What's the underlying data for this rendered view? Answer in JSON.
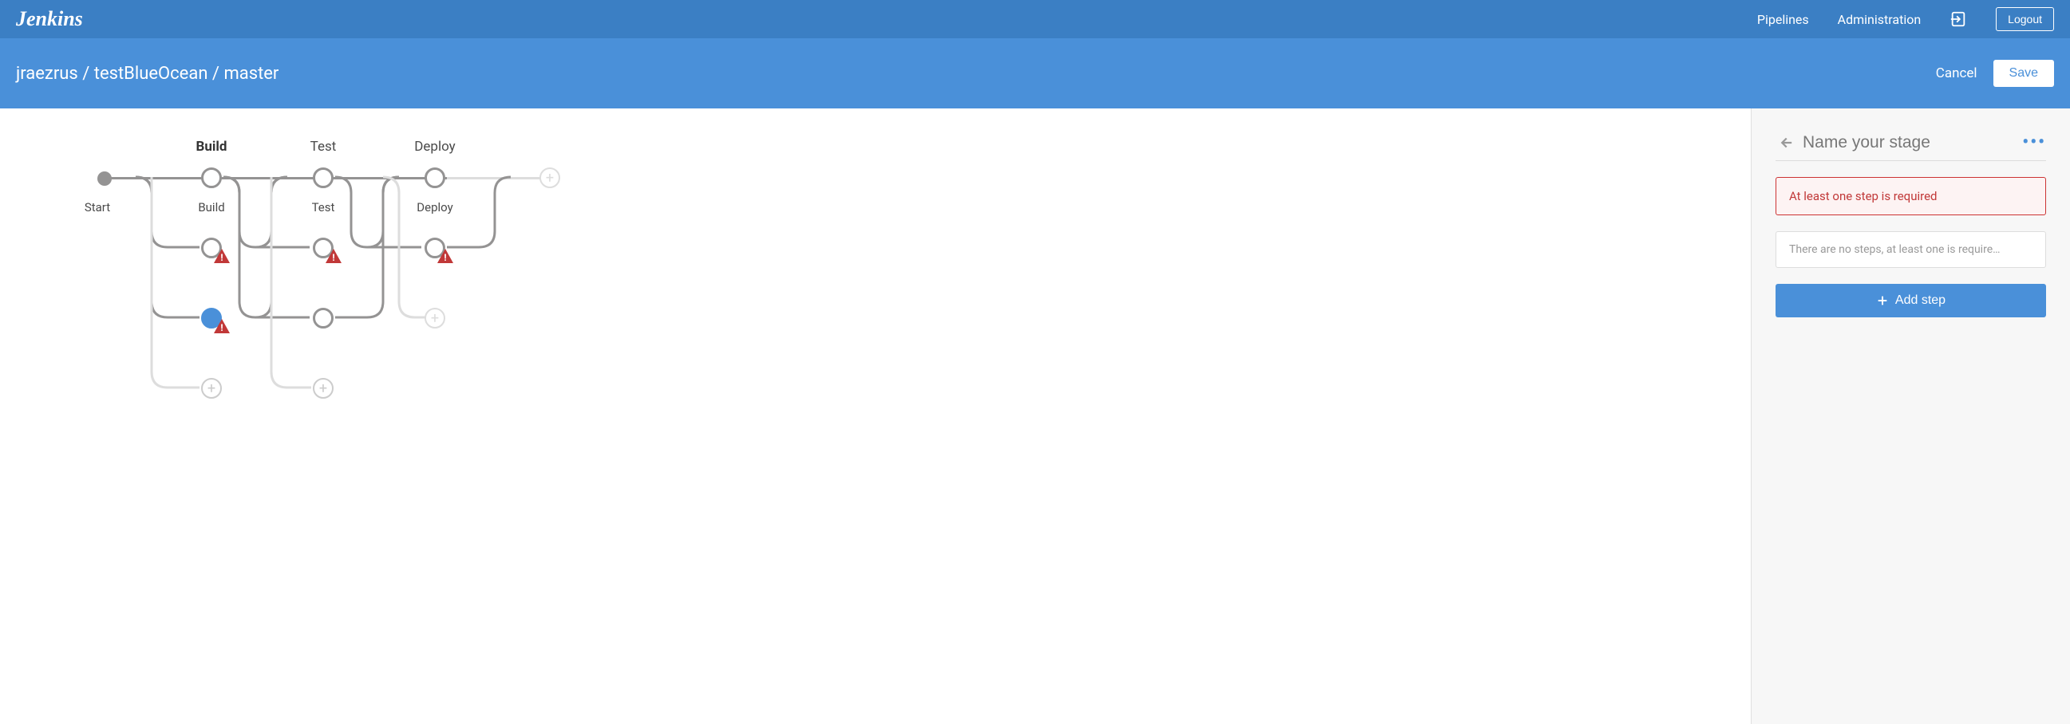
{
  "header": {
    "logo": "Jenkins",
    "nav": {
      "pipelines": "Pipelines",
      "administration": "Administration"
    },
    "logout": "Logout"
  },
  "subheader": {
    "breadcrumb": "jraezrus / testBlueOcean / master",
    "cancel": "Cancel",
    "save": "Save"
  },
  "graph": {
    "start_label": "Start",
    "stages": [
      {
        "header": "Build",
        "label": "Build",
        "bold": true
      },
      {
        "header": "Test",
        "label": "Test",
        "bold": false
      },
      {
        "header": "Deploy",
        "label": "Deploy",
        "bold": false
      }
    ]
  },
  "panel": {
    "stage_name_placeholder": "Name your stage",
    "error": "At least one step is required",
    "empty_steps": "There are no steps, at least one is require…",
    "add_step": "Add step"
  }
}
